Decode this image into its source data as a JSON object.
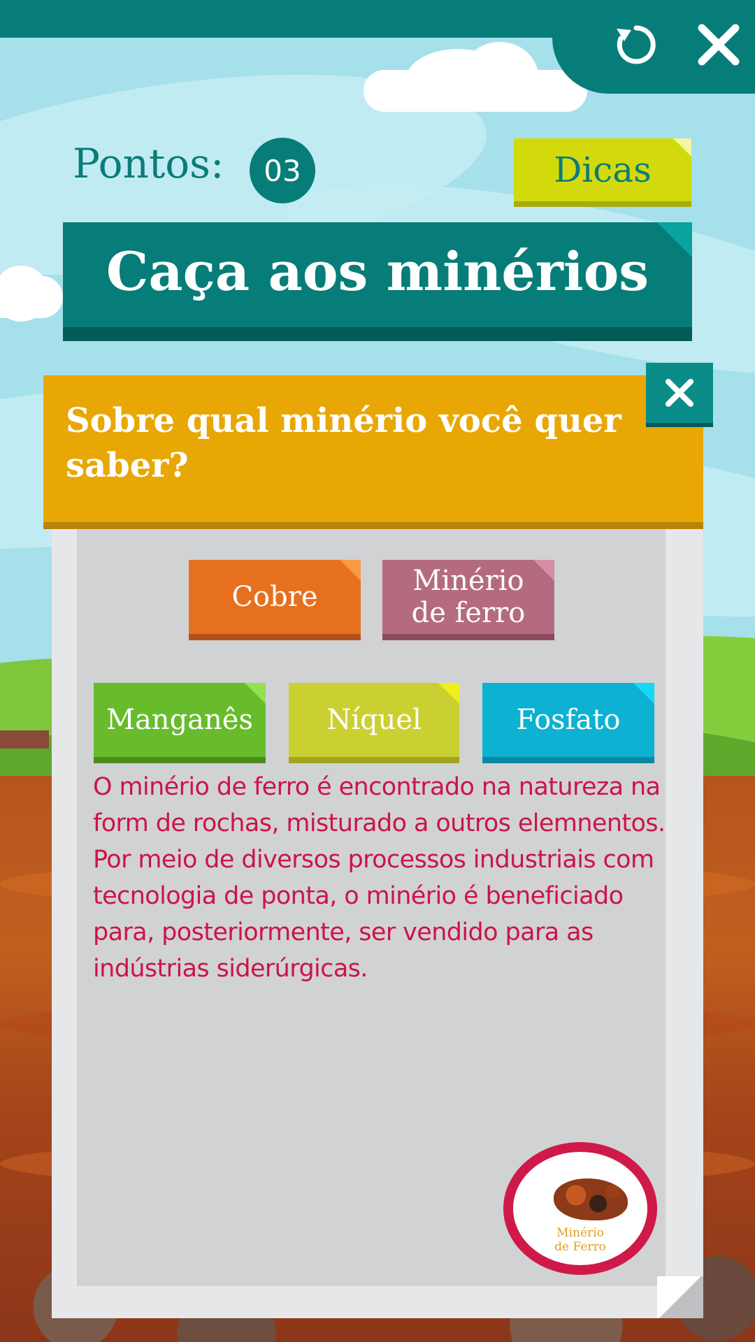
{
  "topbar": {
    "icons": {
      "restart": "restart-icon",
      "close": "close-icon"
    }
  },
  "header": {
    "points_label": "Pontos:",
    "points_value": "03",
    "hints_label": "Dicas"
  },
  "title": "Caça aos minérios",
  "question": {
    "text": "Sobre qual minério você quer saber?",
    "close_icon": "close-icon"
  },
  "options": [
    {
      "label": "Cobre",
      "color": "#e6701f"
    },
    {
      "label": "Minério de ferro",
      "color": "#b46b80"
    },
    {
      "label": "Manganês",
      "color": "#68bc2c"
    },
    {
      "label": "Níquel",
      "color": "#cbd032"
    },
    {
      "label": "Fosfato",
      "color": "#0db1d2"
    }
  ],
  "description": "O minério de ferro é encontrado na natureza na form de rochas, misturado a outros elemnentos. Por meio de diversos processos industriais com tecnologia de ponta, o minério é beneficiado para, posteriormente, ser vendido para as indústrias siderúrgicas.",
  "selected_mineral": {
    "label_line1": "Minério",
    "label_line2": "de Ferro",
    "image": "iron-ore-rock"
  },
  "colors": {
    "teal": "#077d79",
    "question_bg": "#e9a705",
    "description_text": "#cc1447",
    "hints_bg": "#d3da0c"
  }
}
